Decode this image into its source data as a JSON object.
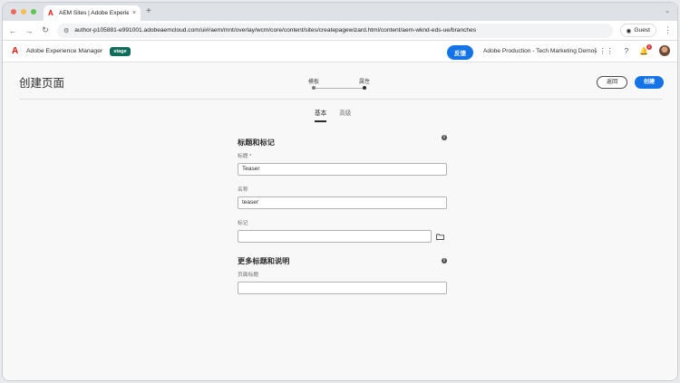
{
  "browser": {
    "tab_title": "AEM Sites | Adobe Experienc",
    "tab_close": "×",
    "new_tab": "+",
    "url": "author-p105881-e991001.adobeaemcloud.com/ui#/aem/mnt/overlay/wcm/core/content/sites/createpagewizard.html/content/aem-wknd-eds-ue/branches",
    "guest_label": "Guest",
    "traffic_lights": [
      "#ed6a5e",
      "#f5bf4f",
      "#61c554"
    ]
  },
  "header": {
    "brand": "Adobe Experience Manager",
    "env_badge": "stage",
    "feedback_label": "反馈",
    "org_name": "Adobe Production - Tech Marketing Demos",
    "notification_count": "2"
  },
  "page": {
    "title": "创建页面",
    "wizard_steps": [
      "模板",
      "属性"
    ],
    "back_label": "返回",
    "create_label": "创建",
    "tabs": [
      "基本",
      "高级"
    ],
    "active_tab": "基本"
  },
  "form": {
    "section1_title": "标题和标记",
    "title_label": "标题 *",
    "title_value": "Teaser",
    "name_label": "名称",
    "name_value": "teaser",
    "tags_label": "标记",
    "tags_value": "",
    "section2_title": "更多标题和说明",
    "page_title_label": "页面标题",
    "page_title_value": ""
  }
}
